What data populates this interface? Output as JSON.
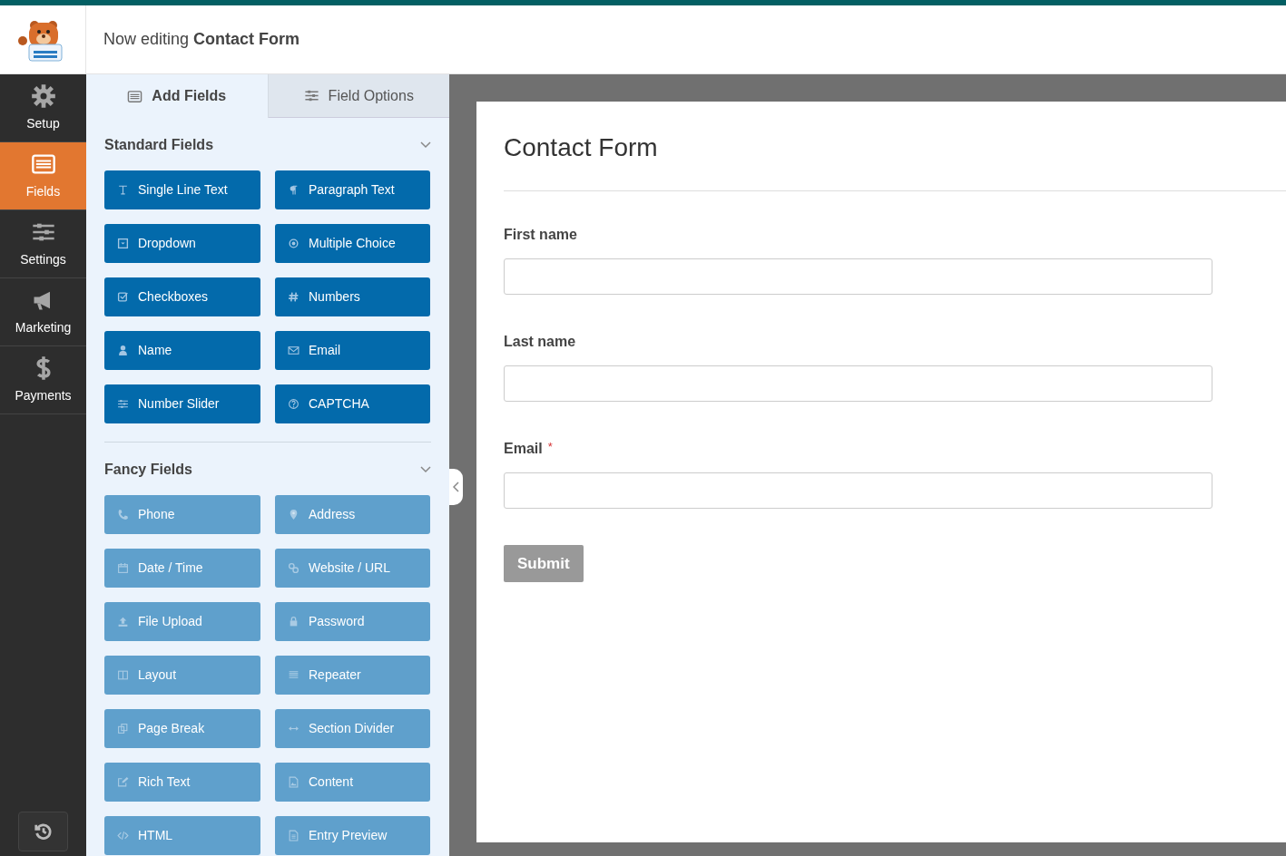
{
  "header": {
    "prefix": "Now editing",
    "form_name": "Contact Form"
  },
  "sidebar": {
    "items": [
      {
        "label": "Setup",
        "kind": "gear",
        "selected": false
      },
      {
        "label": "Fields",
        "kind": "list",
        "selected": true
      },
      {
        "label": "Settings",
        "kind": "sliders",
        "selected": false
      },
      {
        "label": "Marketing",
        "kind": "megaphone",
        "selected": false
      },
      {
        "label": "Payments",
        "kind": "dollar",
        "selected": false
      }
    ]
  },
  "tabs": [
    {
      "label": "Add Fields",
      "kind": "list",
      "selected": true
    },
    {
      "label": "Field Options",
      "kind": "sliders",
      "selected": false
    }
  ],
  "groups": [
    {
      "title": "Standard Fields",
      "expanded": true,
      "fields": [
        {
          "label": "Single Line Text",
          "kind": "text",
          "disabled": false
        },
        {
          "label": "Paragraph Text",
          "kind": "pilcrow",
          "disabled": false
        },
        {
          "label": "Dropdown",
          "kind": "dropdown",
          "disabled": false
        },
        {
          "label": "Multiple Choice",
          "kind": "radio",
          "disabled": false
        },
        {
          "label": "Checkboxes",
          "kind": "check",
          "disabled": false
        },
        {
          "label": "Numbers",
          "kind": "hash",
          "disabled": false
        },
        {
          "label": "Name",
          "kind": "user",
          "disabled": false
        },
        {
          "label": "Email",
          "kind": "envelope",
          "disabled": false
        },
        {
          "label": "Number Slider",
          "kind": "sliders",
          "disabled": false
        },
        {
          "label": "CAPTCHA",
          "kind": "question",
          "disabled": false
        }
      ]
    },
    {
      "title": "Fancy Fields",
      "expanded": true,
      "fields": [
        {
          "label": "Phone",
          "kind": "phone",
          "disabled": true
        },
        {
          "label": "Address",
          "kind": "pin",
          "disabled": true
        },
        {
          "label": "Date / Time",
          "kind": "calendar",
          "disabled": true
        },
        {
          "label": "Website / URL",
          "kind": "link",
          "disabled": true
        },
        {
          "label": "File Upload",
          "kind": "upload",
          "disabled": true
        },
        {
          "label": "Password",
          "kind": "lock",
          "disabled": true
        },
        {
          "label": "Layout",
          "kind": "columns",
          "disabled": true
        },
        {
          "label": "Repeater",
          "kind": "lines",
          "disabled": true
        },
        {
          "label": "Page Break",
          "kind": "copy",
          "disabled": true
        },
        {
          "label": "Section Divider",
          "kind": "arrows",
          "disabled": true
        },
        {
          "label": "Rich Text",
          "kind": "edit",
          "disabled": true
        },
        {
          "label": "Content",
          "kind": "image",
          "disabled": true
        },
        {
          "label": "HTML",
          "kind": "code",
          "disabled": true
        },
        {
          "label": "Entry Preview",
          "kind": "file",
          "disabled": true
        }
      ]
    }
  ],
  "form": {
    "title": "Contact Form",
    "fields": [
      {
        "label": "First name"
      },
      {
        "label": "Last name"
      },
      {
        "label": "Email",
        "required_mark": "*"
      }
    ],
    "submit": "Submit"
  }
}
